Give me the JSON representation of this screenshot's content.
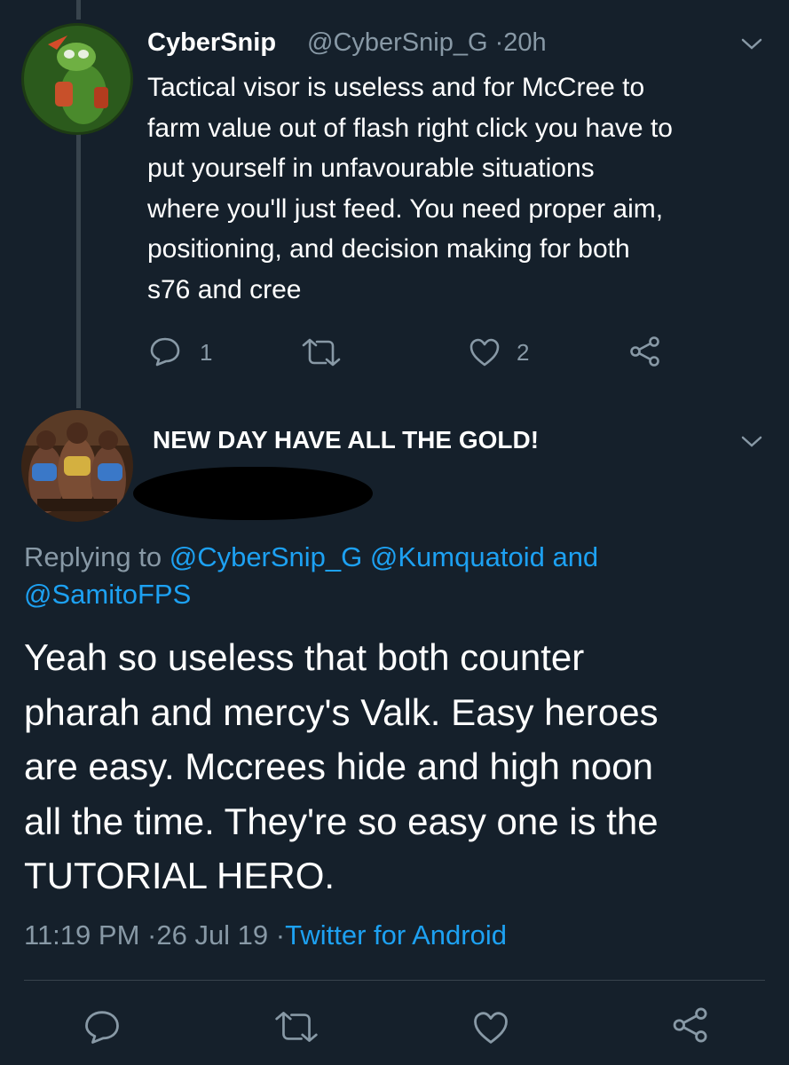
{
  "tweet1": {
    "display_name": "CyberSnip",
    "handle": "@CyberSnip_G",
    "separator": "·",
    "time_ago": "20h",
    "lines": [
      "Tactical visor is useless and for McCree to",
      "farm value out of flash right click you have to",
      "put yourself in unfavourable situations",
      "where you'll just feed. You need proper aim,",
      "positioning, and decision making for both",
      "s76 and cree"
    ],
    "reply_count": "1",
    "like_count": "2"
  },
  "tweet2": {
    "display_name": "NEW DAY HAVE ALL THE GOLD!",
    "replying_prefix": "Replying to",
    "replying_users": [
      "@CyberSnip_G",
      "@Kumquatoid"
    ],
    "replying_and": "and",
    "replying_last": "@SamitoFPS",
    "lines": [
      "Yeah so useless that both counter",
      "pharah and mercy's Valk. Easy heroes",
      "are easy. Mccrees hide and high noon",
      "all the time. They're so easy one is the",
      "TUTORIAL HERO."
    ],
    "timestamp": "11:19 PM",
    "date": "26 Jul 19",
    "separator": "·",
    "source": "Twitter for Android"
  },
  "colors": {
    "background": "#15202b",
    "text": "#ffffff",
    "muted": "#8899a6",
    "link": "#1da1f2",
    "divider": "#38444d"
  },
  "icons": [
    "reply-icon",
    "retweet-icon",
    "like-icon",
    "share-icon",
    "chevron-down-icon"
  ]
}
